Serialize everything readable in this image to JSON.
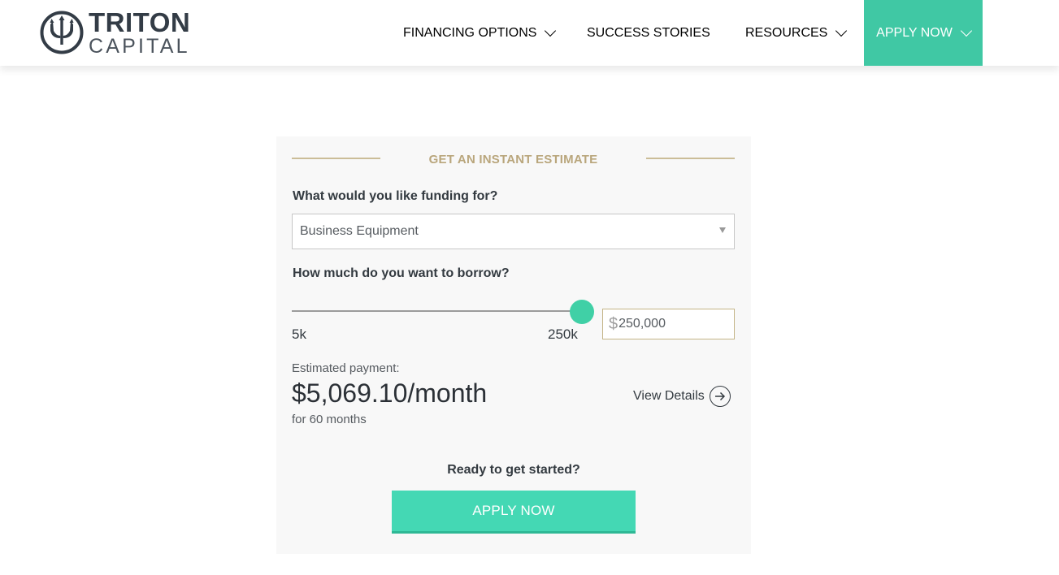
{
  "brand": {
    "name_top": "TRITON",
    "name_bottom": "CAPITAL",
    "logo_icon": "trident-icon"
  },
  "nav": {
    "items": [
      {
        "label": "FINANCING OPTIONS",
        "has_dropdown": true
      },
      {
        "label": "SUCCESS STORIES",
        "has_dropdown": false
      },
      {
        "label": "RESOURCES",
        "has_dropdown": true
      },
      {
        "label": "APPLY NOW",
        "has_dropdown": true
      }
    ]
  },
  "estimator": {
    "title": "GET AN INSTANT ESTIMATE",
    "funding_question": "What would you like funding for?",
    "funding_selected": "Business Equipment",
    "borrow_question": "How much do you want to borrow?",
    "slider": {
      "min_label": "5k",
      "max_label": "250k",
      "value_fraction": 1.0
    },
    "amount_symbol": "$",
    "amount_value": "250,000",
    "payment_label": "Estimated payment:",
    "payment_value": "$5,069.10/month",
    "payment_term": "for 60 months",
    "view_details": "View Details",
    "ready_text": "Ready to get started?",
    "apply_button": "APPLY NOW"
  },
  "colors": {
    "accent": "#40c8a4",
    "gold": "#b9a67c",
    "text_dark": "#333a40"
  }
}
